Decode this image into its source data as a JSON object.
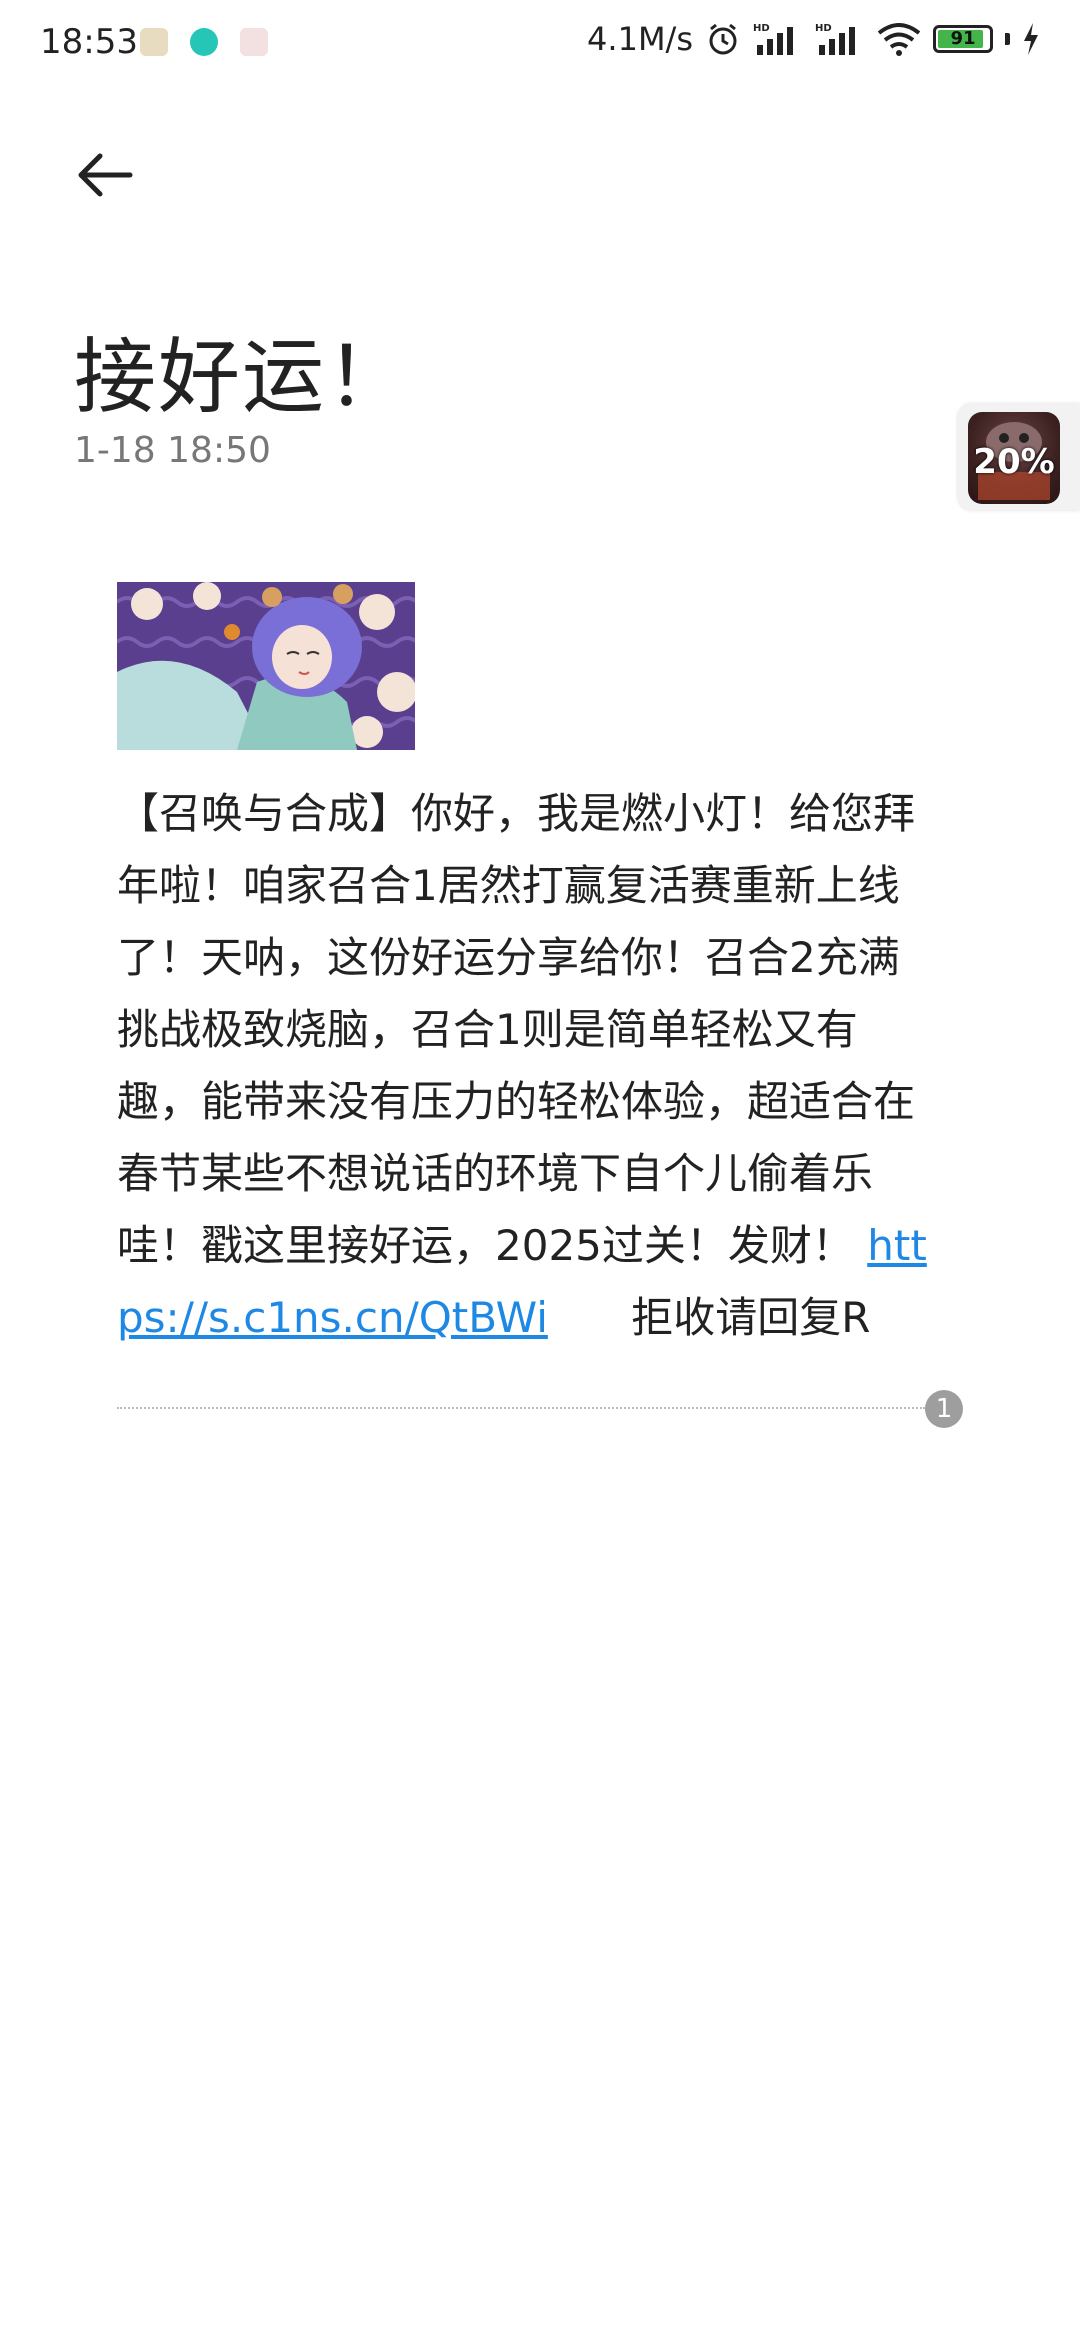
{
  "status_bar": {
    "time": "18:53",
    "net_speed": "4.1M/s",
    "battery_level": "91",
    "battery_fraction": 0.91,
    "icons": [
      "calendar-icon",
      "app-notification-icon",
      "gallery-icon",
      "alarm-icon",
      "signal-hd-icon",
      "signal-hd-icon",
      "wifi-icon",
      "charging-icon"
    ]
  },
  "header": {
    "back_icon": "arrow-left-icon",
    "title": "接好运！",
    "timestamp": "1-18 18:50"
  },
  "floating_widget": {
    "percent": "20%"
  },
  "message": {
    "image": "anime-banner-image",
    "body": "【召唤与合成】你好，我是燃小灯！给您拜年啦！咱家召合1居然打赢复活赛重新上线了！天呐，这份好运分享给你！召合2充满挑战极致烧脑，召合1则是简单轻松又有趣，能带来没有压力的轻松体验，超适合在春节某些不想说话的环境下自个儿偷着乐哇！戳这里接好运，2025过关！发财！",
    "link": "https://s.c1ns.cn/QtBWi",
    "suffix": "拒收请回复R"
  },
  "thread": {
    "count": "1"
  },
  "colors": {
    "link": "#1e88e5",
    "battery": "#43b54a",
    "badge": "#9e9e9e"
  }
}
